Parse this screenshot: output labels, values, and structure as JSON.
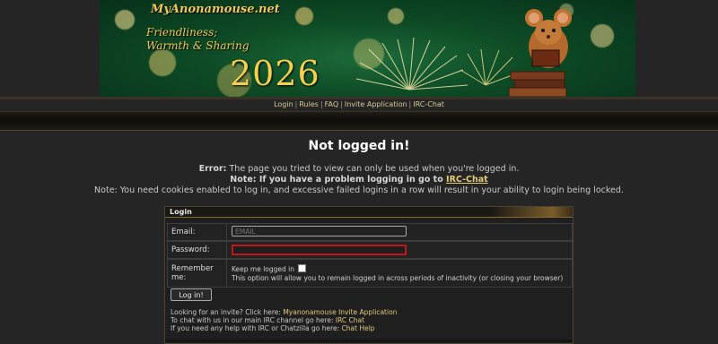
{
  "banner": {
    "site_name": "MyAnonamouse.net",
    "tagline_line1": "Friendliness;",
    "tagline_line2": "Warmth & Sharing",
    "year": "2026"
  },
  "nav": {
    "items": [
      "Login",
      "Rules",
      "FAQ",
      "Invite Application",
      "IRC-Chat"
    ],
    "separator": "|"
  },
  "page": {
    "title": "Not logged in!",
    "error_label": "Error:",
    "error_text": " The page you tried to view can only be used when you're logged in.",
    "note_irc_text": "Note: If you have a problem logging in go to ",
    "note_irc_link": "IRC-Chat",
    "note_cookies": "Note: You need cookies enabled to log in, and excessive failed logins in a row will result in your ability to login being locked."
  },
  "login": {
    "header": "Login",
    "email_label": "Email:",
    "email_placeholder": "EMAIL",
    "password_label": "Password:",
    "password_value": "",
    "remember_label": "Remember me:",
    "keep_label": "Keep me logged in",
    "keep_note": "This option will allow you to remain logged in across periods of inactivity (or closing your browser)",
    "button_label": "Log in!",
    "help1_text": "Looking for an invite? Click here: ",
    "help1_link": "Myanonamouse Invite Application",
    "help2_text": "To chat with us in our main IRC channel go here: ",
    "help2_link": "IRC Chat",
    "help3_text": "If you need any help with IRC or Chatzilla go here: ",
    "help3_link": "Chat Help"
  },
  "colors": {
    "accent_gold": "#e4cc74",
    "error_red": "#c41616",
    "background": "#252525"
  }
}
